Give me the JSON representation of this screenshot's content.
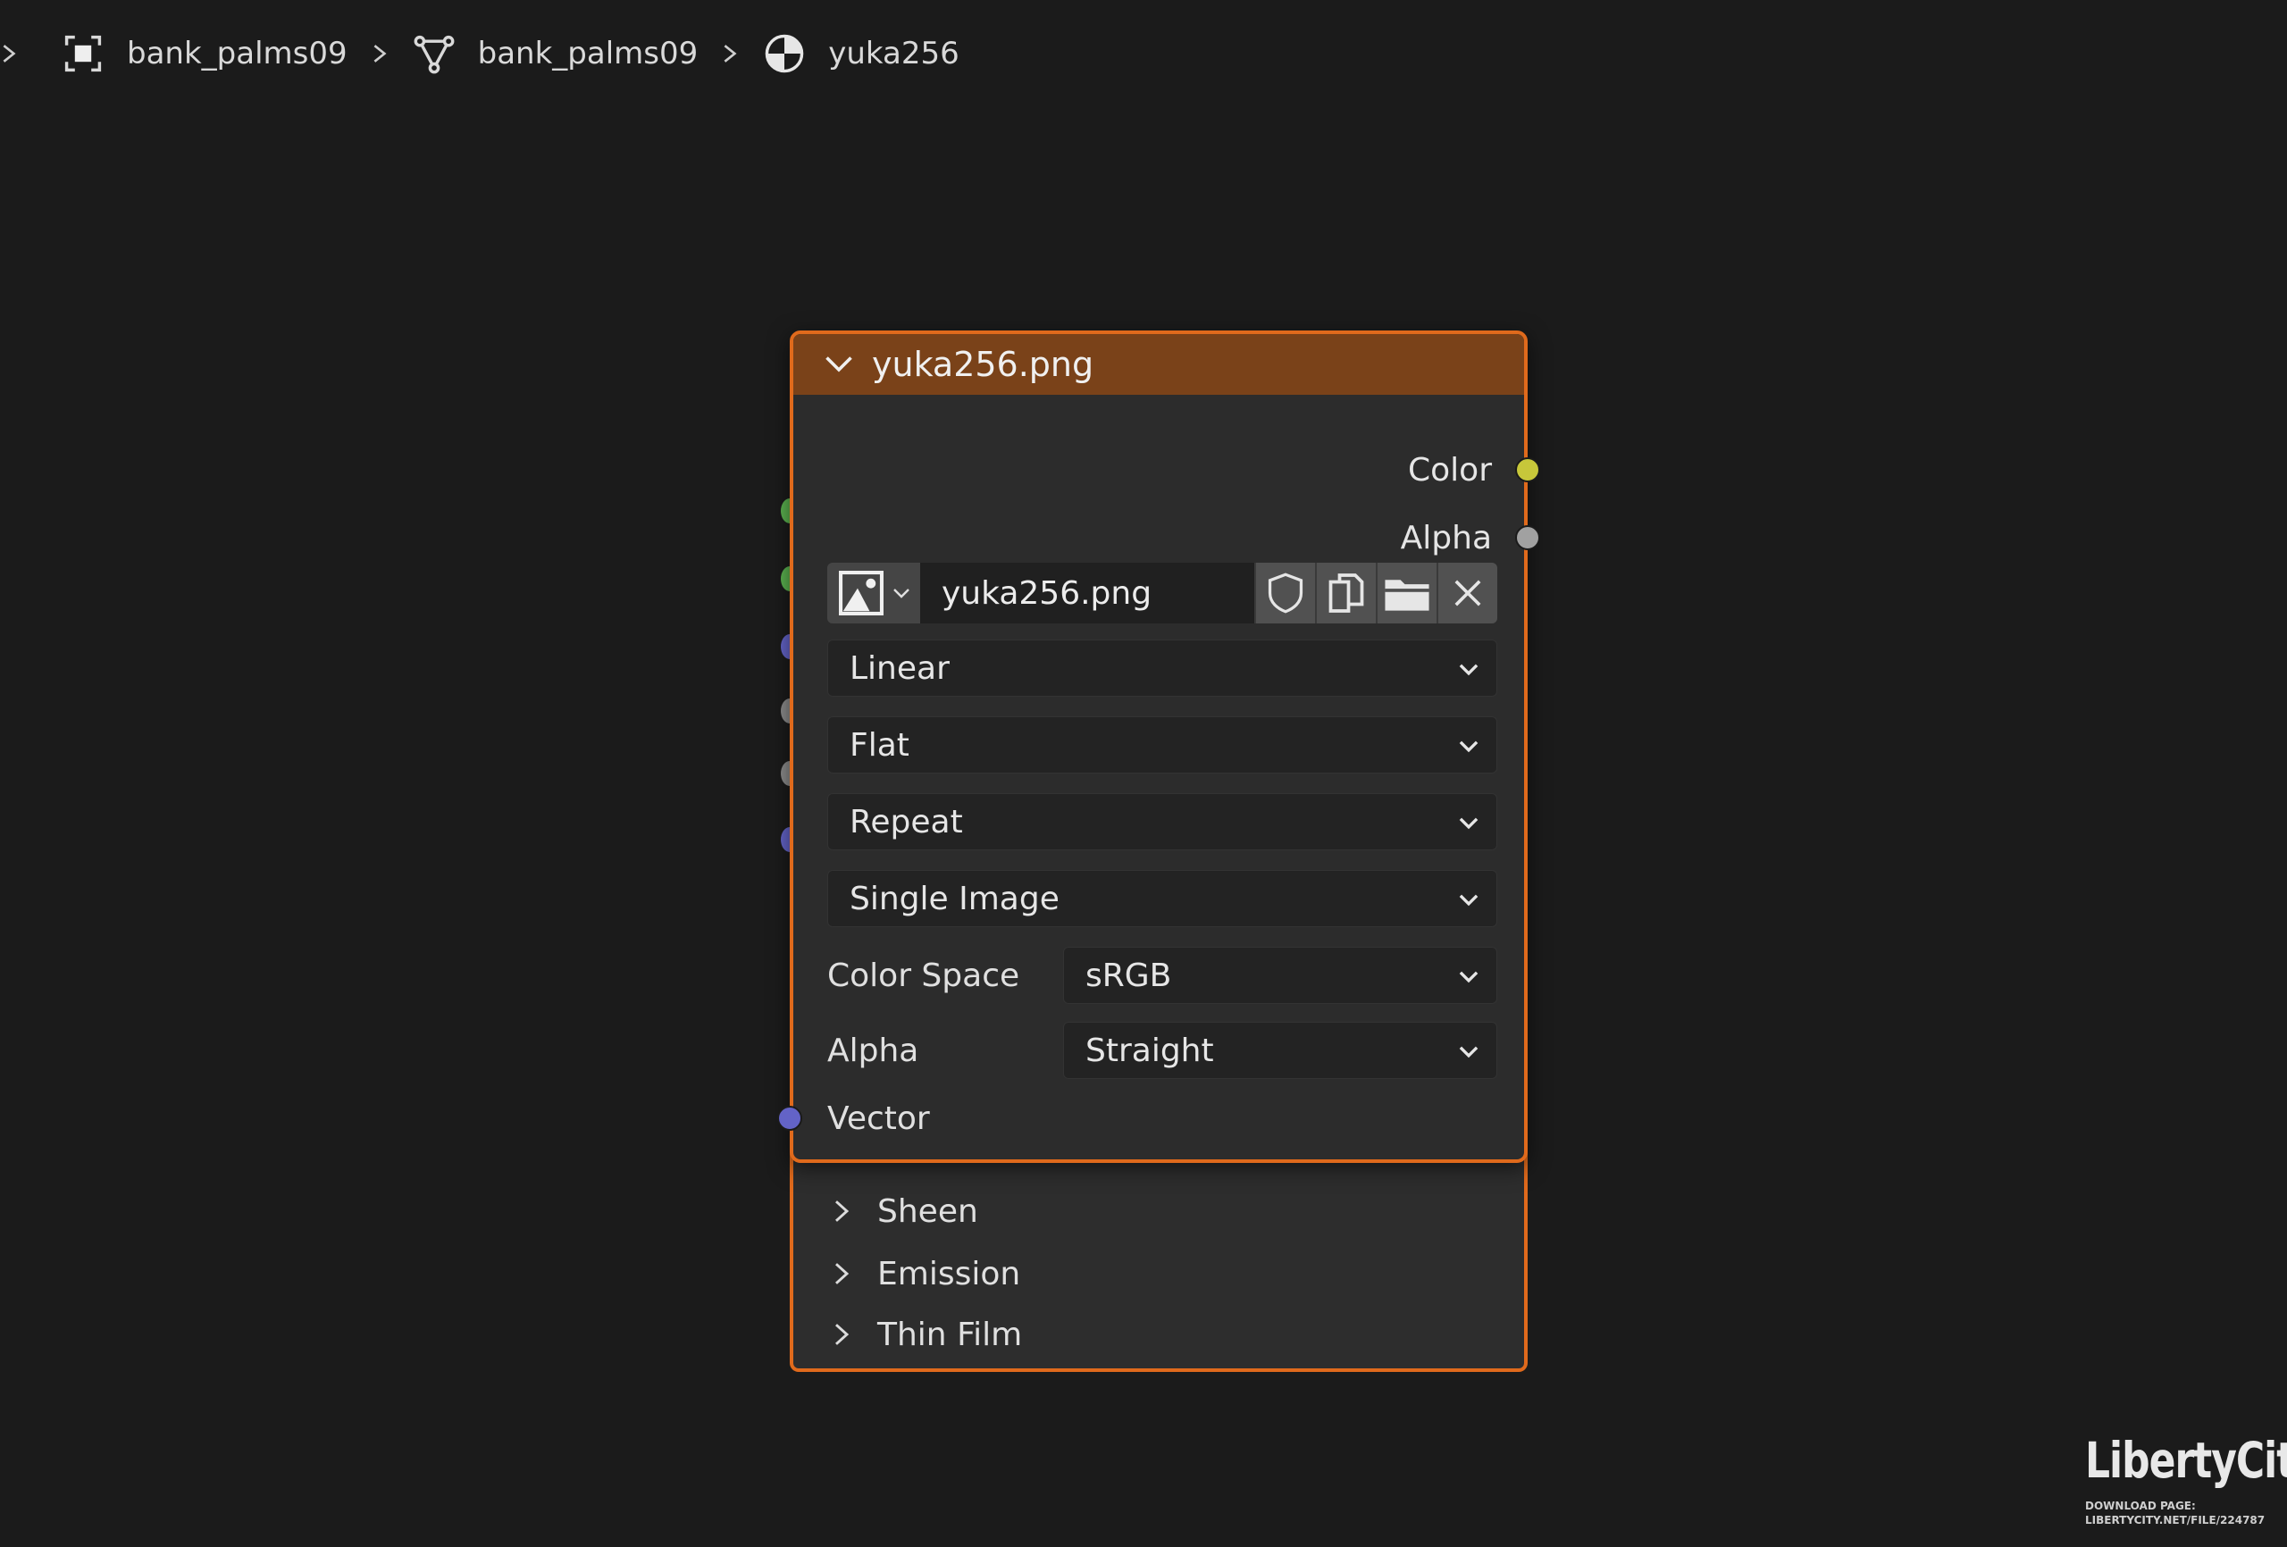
{
  "breadcrumb": {
    "items": [
      {
        "label": "bank_palms09",
        "icon": "object-icon"
      },
      {
        "label": "bank_palms09",
        "icon": "mesh-data-icon"
      },
      {
        "label": "yuka256",
        "icon": "material-icon"
      }
    ]
  },
  "image_node": {
    "title": "yuka256.png",
    "outputs": {
      "color": {
        "label": "Color",
        "socket_color": "#c7c73a"
      },
      "alpha": {
        "label": "Alpha",
        "socket_color": "#a1a1a1"
      }
    },
    "image_name": "yuka256.png",
    "interpolation": "Linear",
    "projection": "Flat",
    "extension": "Repeat",
    "source": "Single Image",
    "color_space": {
      "label": "Color Space",
      "value": "sRGB"
    },
    "alpha_mode": {
      "label": "Alpha",
      "value": "Straight"
    },
    "input": {
      "label": "Vector",
      "socket_color": "#6363c7"
    },
    "header_color": "#7a4219",
    "border_color": "#e06a1c"
  },
  "bsdf_node": {
    "panels": [
      "Sheen",
      "Emission",
      "Thin Film"
    ]
  },
  "watermark": {
    "logo": "LibertyCity",
    "line1": "DOWNLOAD PAGE:",
    "line2": "LIBERTYCITY.NET/FILE/224787"
  }
}
